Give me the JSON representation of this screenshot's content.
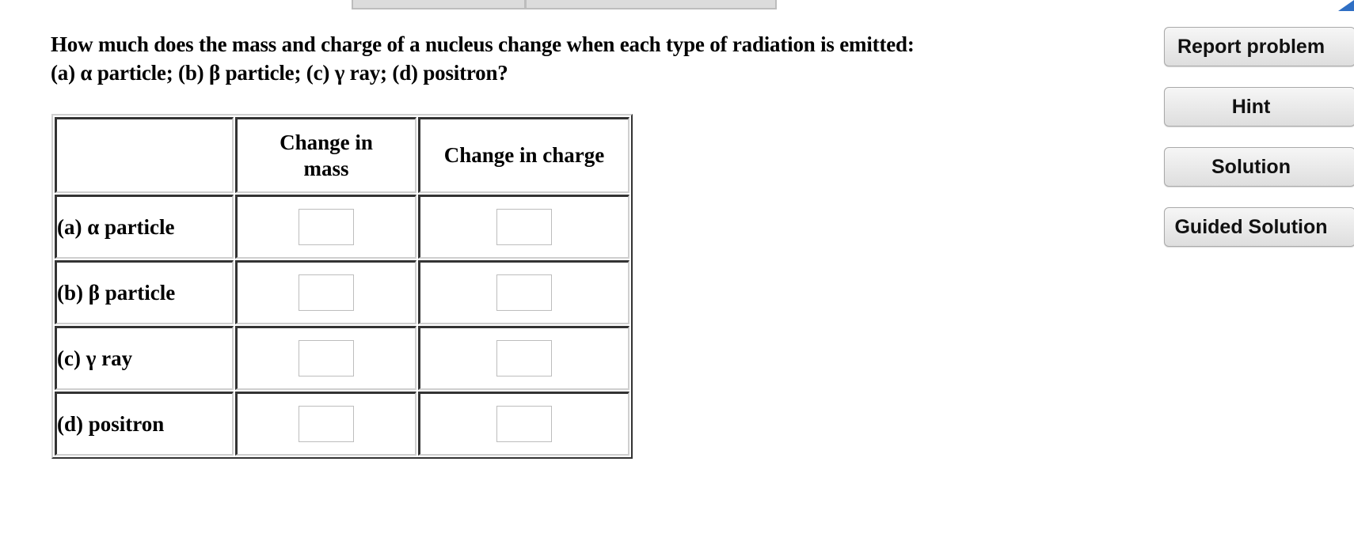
{
  "question": {
    "line1": "How much does the mass and charge of a nucleus change when each type of radiation is emitted:",
    "line2": "(a) α particle; (b) β particle; (c) γ ray; (d) positron?"
  },
  "table": {
    "headers": {
      "corner": "",
      "mass_line1": "Change in",
      "mass_line2": "mass",
      "charge": "Change in charge"
    },
    "rows": [
      {
        "label": "(a) α particle",
        "mass_value": "",
        "charge_value": ""
      },
      {
        "label": "(b) β particle",
        "mass_value": "",
        "charge_value": ""
      },
      {
        "label": "(c) γ ray",
        "mass_value": "",
        "charge_value": ""
      },
      {
        "label": "(d) positron",
        "mass_value": "",
        "charge_value": ""
      }
    ]
  },
  "side_buttons": {
    "report_problem": "Report problem",
    "hint": "Hint",
    "solution": "Solution",
    "guided_solution": "Guided Solution"
  },
  "colors": {
    "corner_flag": "#2f6fc4",
    "button_border": "#a9a9a9",
    "input_border": "#bdbdbd"
  }
}
